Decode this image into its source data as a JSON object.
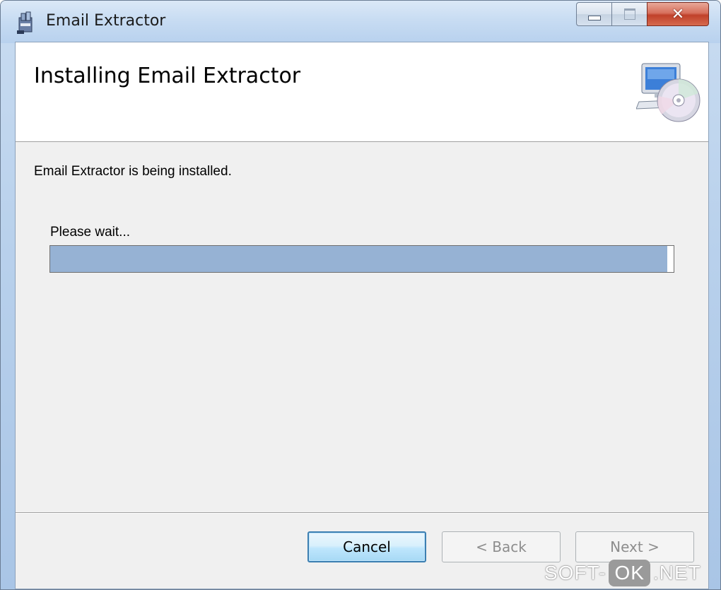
{
  "window": {
    "title": "Email Extractor",
    "close_glyph": "✕"
  },
  "banner": {
    "title": "Installing Email Extractor",
    "graphic_icon": "computer-cd-icon"
  },
  "body": {
    "status_text": "Email Extractor is being installed.",
    "wait_label": "Please wait...",
    "progress_fraction": 0.99
  },
  "buttons": {
    "cancel": "Cancel",
    "back": "< Back",
    "next": "Next >"
  },
  "watermark": {
    "left": "SOFT-",
    "box": "OK",
    "right": ".NET"
  },
  "colors": {
    "progress_fill": "#96b2d4",
    "focus_border": "#3c7fb1"
  }
}
